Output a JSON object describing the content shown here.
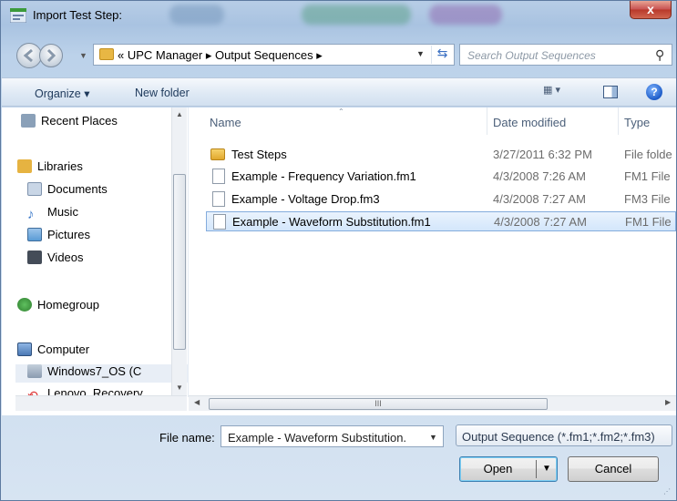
{
  "window": {
    "title": "Import Test Step:",
    "close_label": "x"
  },
  "address": {
    "path": "« UPC Manager ▸ Output Sequences ▸",
    "search_placeholder": "Search Output Sequences"
  },
  "toolbar": {
    "organize_label": "Organize ▾",
    "new_folder_label": "New folder",
    "views_label": "▦ ▾",
    "help_label": "?"
  },
  "sidebar": {
    "items": [
      {
        "label": "Recent Places",
        "icon": "recent-places-icon",
        "color": "#8aa0b8"
      },
      {
        "label": "Libraries",
        "icon": "libraries-icon",
        "color": "#e6b341"
      },
      {
        "label": "Documents",
        "icon": "documents-icon",
        "color": "#c9d6e6"
      },
      {
        "label": "Music",
        "icon": "music-icon",
        "color": "#3a78c9"
      },
      {
        "label": "Pictures",
        "icon": "pictures-icon",
        "color": "#5a9bd5"
      },
      {
        "label": "Videos",
        "icon": "videos-icon",
        "color": "#444c58"
      },
      {
        "label": "Homegroup",
        "icon": "homegroup-icon",
        "color": "#3b8f3b"
      },
      {
        "label": "Computer",
        "icon": "computer-icon",
        "color": "#4b79b4"
      },
      {
        "label": "Windows7_OS (C",
        "icon": "drive-icon",
        "color": "#8a9bb0"
      },
      {
        "label": "Lenovo_Recovery",
        "icon": "recovery-drive-icon",
        "color": "#d33"
      }
    ]
  },
  "columns": {
    "name": "Name",
    "date": "Date modified",
    "type": "Type"
  },
  "files": [
    {
      "name": "Test Steps",
      "date": "3/27/2011 6:32 PM",
      "type": "File folde",
      "kind": "folder"
    },
    {
      "name": "Example - Frequency Variation.fm1",
      "date": "4/3/2008 7:26 AM",
      "type": "FM1 File",
      "kind": "file"
    },
    {
      "name": "Example - Voltage Drop.fm3",
      "date": "4/3/2008 7:27 AM",
      "type": "FM3 File",
      "kind": "file"
    },
    {
      "name": "Example - Waveform Substitution.fm1",
      "date": "4/3/2008 7:27 AM",
      "type": "FM1 File",
      "kind": "file",
      "selected": true
    }
  ],
  "footer": {
    "file_name_label": "File name:",
    "file_name_value": "Example - Waveform Substitution.",
    "filter_value": "Output Sequence (*.fm1;*.fm2;*.fm3)",
    "open_label": "Open",
    "cancel_label": "Cancel"
  },
  "hscroll_label": "III"
}
